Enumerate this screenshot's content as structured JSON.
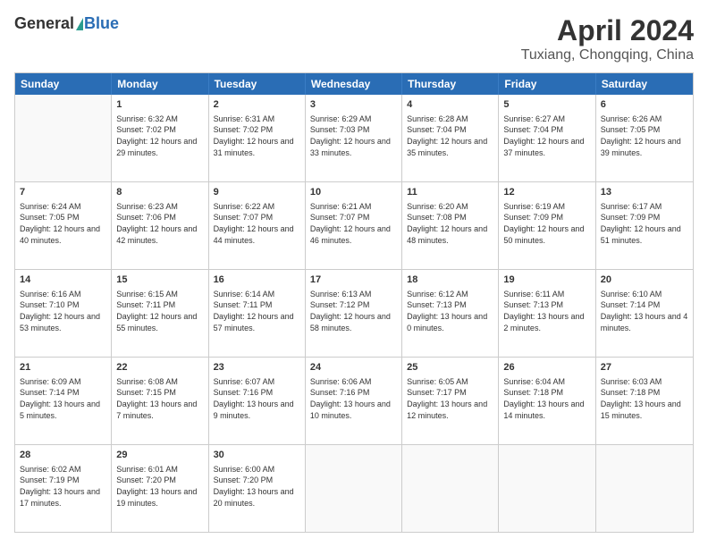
{
  "header": {
    "logo_general": "General",
    "logo_blue": "Blue",
    "month_title": "April 2024",
    "location": "Tuxiang, Chongqing, China"
  },
  "weekdays": [
    "Sunday",
    "Monday",
    "Tuesday",
    "Wednesday",
    "Thursday",
    "Friday",
    "Saturday"
  ],
  "weeks": [
    [
      {
        "day": "",
        "sunrise": "",
        "sunset": "",
        "daylight": ""
      },
      {
        "day": "1",
        "sunrise": "Sunrise: 6:32 AM",
        "sunset": "Sunset: 7:02 PM",
        "daylight": "Daylight: 12 hours and 29 minutes."
      },
      {
        "day": "2",
        "sunrise": "Sunrise: 6:31 AM",
        "sunset": "Sunset: 7:02 PM",
        "daylight": "Daylight: 12 hours and 31 minutes."
      },
      {
        "day": "3",
        "sunrise": "Sunrise: 6:29 AM",
        "sunset": "Sunset: 7:03 PM",
        "daylight": "Daylight: 12 hours and 33 minutes."
      },
      {
        "day": "4",
        "sunrise": "Sunrise: 6:28 AM",
        "sunset": "Sunset: 7:04 PM",
        "daylight": "Daylight: 12 hours and 35 minutes."
      },
      {
        "day": "5",
        "sunrise": "Sunrise: 6:27 AM",
        "sunset": "Sunset: 7:04 PM",
        "daylight": "Daylight: 12 hours and 37 minutes."
      },
      {
        "day": "6",
        "sunrise": "Sunrise: 6:26 AM",
        "sunset": "Sunset: 7:05 PM",
        "daylight": "Daylight: 12 hours and 39 minutes."
      }
    ],
    [
      {
        "day": "7",
        "sunrise": "Sunrise: 6:24 AM",
        "sunset": "Sunset: 7:05 PM",
        "daylight": "Daylight: 12 hours and 40 minutes."
      },
      {
        "day": "8",
        "sunrise": "Sunrise: 6:23 AM",
        "sunset": "Sunset: 7:06 PM",
        "daylight": "Daylight: 12 hours and 42 minutes."
      },
      {
        "day": "9",
        "sunrise": "Sunrise: 6:22 AM",
        "sunset": "Sunset: 7:07 PM",
        "daylight": "Daylight: 12 hours and 44 minutes."
      },
      {
        "day": "10",
        "sunrise": "Sunrise: 6:21 AM",
        "sunset": "Sunset: 7:07 PM",
        "daylight": "Daylight: 12 hours and 46 minutes."
      },
      {
        "day": "11",
        "sunrise": "Sunrise: 6:20 AM",
        "sunset": "Sunset: 7:08 PM",
        "daylight": "Daylight: 12 hours and 48 minutes."
      },
      {
        "day": "12",
        "sunrise": "Sunrise: 6:19 AM",
        "sunset": "Sunset: 7:09 PM",
        "daylight": "Daylight: 12 hours and 50 minutes."
      },
      {
        "day": "13",
        "sunrise": "Sunrise: 6:17 AM",
        "sunset": "Sunset: 7:09 PM",
        "daylight": "Daylight: 12 hours and 51 minutes."
      }
    ],
    [
      {
        "day": "14",
        "sunrise": "Sunrise: 6:16 AM",
        "sunset": "Sunset: 7:10 PM",
        "daylight": "Daylight: 12 hours and 53 minutes."
      },
      {
        "day": "15",
        "sunrise": "Sunrise: 6:15 AM",
        "sunset": "Sunset: 7:11 PM",
        "daylight": "Daylight: 12 hours and 55 minutes."
      },
      {
        "day": "16",
        "sunrise": "Sunrise: 6:14 AM",
        "sunset": "Sunset: 7:11 PM",
        "daylight": "Daylight: 12 hours and 57 minutes."
      },
      {
        "day": "17",
        "sunrise": "Sunrise: 6:13 AM",
        "sunset": "Sunset: 7:12 PM",
        "daylight": "Daylight: 12 hours and 58 minutes."
      },
      {
        "day": "18",
        "sunrise": "Sunrise: 6:12 AM",
        "sunset": "Sunset: 7:13 PM",
        "daylight": "Daylight: 13 hours and 0 minutes."
      },
      {
        "day": "19",
        "sunrise": "Sunrise: 6:11 AM",
        "sunset": "Sunset: 7:13 PM",
        "daylight": "Daylight: 13 hours and 2 minutes."
      },
      {
        "day": "20",
        "sunrise": "Sunrise: 6:10 AM",
        "sunset": "Sunset: 7:14 PM",
        "daylight": "Daylight: 13 hours and 4 minutes."
      }
    ],
    [
      {
        "day": "21",
        "sunrise": "Sunrise: 6:09 AM",
        "sunset": "Sunset: 7:14 PM",
        "daylight": "Daylight: 13 hours and 5 minutes."
      },
      {
        "day": "22",
        "sunrise": "Sunrise: 6:08 AM",
        "sunset": "Sunset: 7:15 PM",
        "daylight": "Daylight: 13 hours and 7 minutes."
      },
      {
        "day": "23",
        "sunrise": "Sunrise: 6:07 AM",
        "sunset": "Sunset: 7:16 PM",
        "daylight": "Daylight: 13 hours and 9 minutes."
      },
      {
        "day": "24",
        "sunrise": "Sunrise: 6:06 AM",
        "sunset": "Sunset: 7:16 PM",
        "daylight": "Daylight: 13 hours and 10 minutes."
      },
      {
        "day": "25",
        "sunrise": "Sunrise: 6:05 AM",
        "sunset": "Sunset: 7:17 PM",
        "daylight": "Daylight: 13 hours and 12 minutes."
      },
      {
        "day": "26",
        "sunrise": "Sunrise: 6:04 AM",
        "sunset": "Sunset: 7:18 PM",
        "daylight": "Daylight: 13 hours and 14 minutes."
      },
      {
        "day": "27",
        "sunrise": "Sunrise: 6:03 AM",
        "sunset": "Sunset: 7:18 PM",
        "daylight": "Daylight: 13 hours and 15 minutes."
      }
    ],
    [
      {
        "day": "28",
        "sunrise": "Sunrise: 6:02 AM",
        "sunset": "Sunset: 7:19 PM",
        "daylight": "Daylight: 13 hours and 17 minutes."
      },
      {
        "day": "29",
        "sunrise": "Sunrise: 6:01 AM",
        "sunset": "Sunset: 7:20 PM",
        "daylight": "Daylight: 13 hours and 19 minutes."
      },
      {
        "day": "30",
        "sunrise": "Sunrise: 6:00 AM",
        "sunset": "Sunset: 7:20 PM",
        "daylight": "Daylight: 13 hours and 20 minutes."
      },
      {
        "day": "",
        "sunrise": "",
        "sunset": "",
        "daylight": ""
      },
      {
        "day": "",
        "sunrise": "",
        "sunset": "",
        "daylight": ""
      },
      {
        "day": "",
        "sunrise": "",
        "sunset": "",
        "daylight": ""
      },
      {
        "day": "",
        "sunrise": "",
        "sunset": "",
        "daylight": ""
      }
    ]
  ]
}
